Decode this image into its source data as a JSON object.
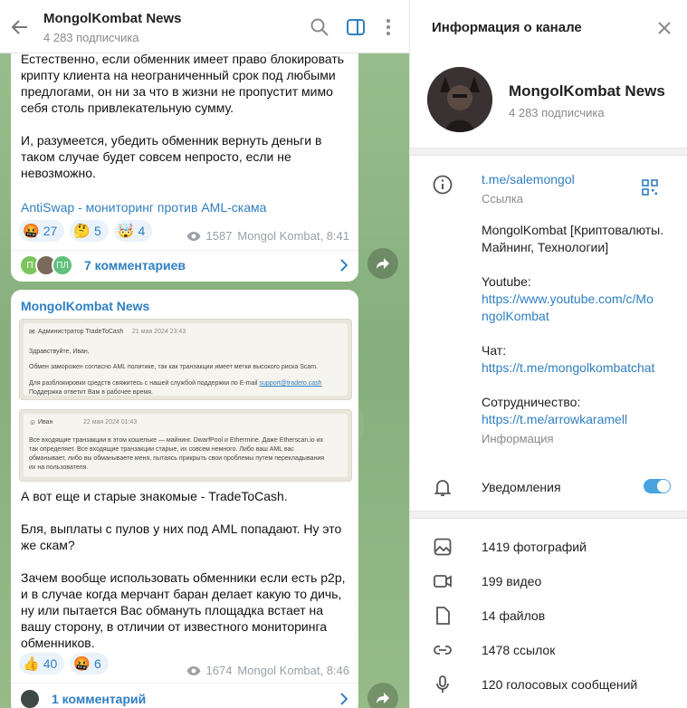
{
  "chat": {
    "title": "MongolKombat News",
    "subscribers": "4 283 подписчика"
  },
  "post1": {
    "text": "Естественно, если обменник имеет право блокировать крипту клиента на неограниченный срок под любыми предлогами, он ни за что в жизни не пропустит мимо себя столь привлекательную сумму.\n\nИ, разумеется, убедить обменник вернуть деньги в таком случае будет совсем непросто, если не невозможно.",
    "link": "AntiSwap - мониторинг против AML-скама",
    "reactions": [
      {
        "emoji": "🤬",
        "count": "27"
      },
      {
        "emoji": "🤔",
        "count": "5"
      },
      {
        "emoji": "🤯",
        "count": "4"
      }
    ],
    "views": "1587",
    "signature": "Mongol Kombat, 8:41",
    "comment_avatars": [
      "П",
      "",
      "ПЛ"
    ],
    "comments": "7 комментариев"
  },
  "post2": {
    "sender": "MongolKombat News",
    "shot1": {
      "author": "Администратор TradeToCash",
      "date": "21 мая 2024 23:43",
      "greeting": "Здравствуйте, Иван,",
      "body": "Обмен заморожен согласно AML политике, так как транзакции имеет метки высокого риска Scam.",
      "footer1": "Для разблокировки средств свяжитесь с нашей службой поддержки по E-mail",
      "email": "support@tradeto.cash",
      "footer2": "Поддержка ответит Вам в рабочее время."
    },
    "shot2": {
      "author": "Иван",
      "date": "22 мая 2024 01:43",
      "body": "Все входящие транзакции в этом кошельке — майнинг. DwarfPool и Ethermine. Даже Etherscan.io их так определяет. Все входящие транзакции старые, их совсем немного. Либо ваш AML вас обманывает, либо вы обманываете меня, пытаясь прикрыть свои проблемы путем перекладывания их на пользователя."
    },
    "text": "А вот еще и старые знакомые - TradeToCash.\n\nБля, выплаты с пулов у них под AML попадают. Ну это же скам?\n\nЗачем вообще использовать обменники если есть p2p, и в случае когда мерчант баран делает какую то дичь, ну или пытается Вас обмануть площадка встает на вашу сторону, в отличии от известного мониторинга обменников.",
    "reactions": [
      {
        "emoji": "👍",
        "count": "40"
      },
      {
        "emoji": "🤬",
        "count": "6"
      }
    ],
    "views": "1674",
    "signature": "Mongol Kombat, 8:46",
    "comments": "1 комментарий"
  },
  "panel": {
    "title": "Информация о канале",
    "name": "MongolKombat News",
    "subscribers": "4 283 подписчика",
    "username": "t.me/salemongol",
    "username_caption": "Ссылка",
    "desc_line1": "MongolKombat [Криптовалюты.",
    "desc_line2": "Майнинг, Технологии]",
    "youtube_label": "Youtube:",
    "youtube_link1": "https://www.youtube.com/c/Mo",
    "youtube_link2": "ngolKombat",
    "chat_label": "Чат:",
    "chat_link": "https://t.me/mongolkombatchat",
    "coop_label": "Сотрудничество:",
    "coop_link": "https://t.me/arrowkaramell",
    "info_caption": "Информация",
    "notifications": "Уведомления",
    "notifications_on": true,
    "photos": "1419 фотографий",
    "videos": "199 видео",
    "files": "14 файлов",
    "links": "1478 ссылок",
    "voice": "120 голосовых сообщений"
  },
  "colors": {
    "accent": "#2f7fc1",
    "toggle": "#4aa3df",
    "chat_bg": "#8fb486"
  }
}
